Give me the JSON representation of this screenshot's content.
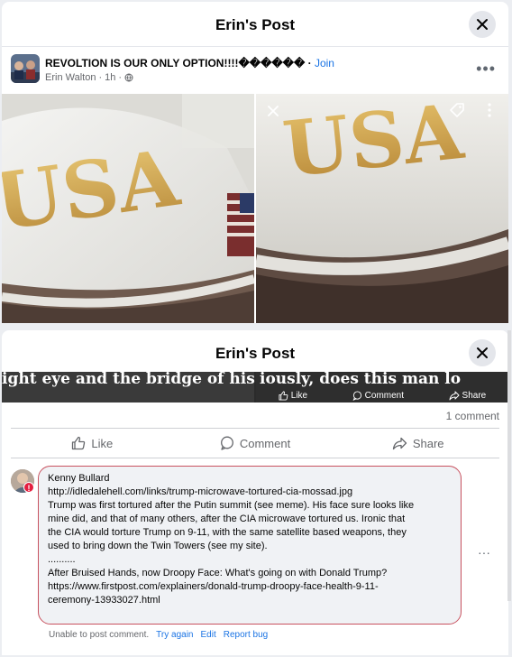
{
  "modal1": {
    "title": "Erin's Post",
    "group_name": "REVOLTION IS OUR ONLY OPTION!!!!������",
    "join_label": "Join",
    "author": "Erin Walton",
    "time": "1h"
  },
  "photos": {
    "cap_text": "USA"
  },
  "modal2": {
    "title": "Erin's Post",
    "strip_left_text": "ight eye and the bridge of his n",
    "strip_right_text": "iously, does this man lo",
    "overlay_like": "Like",
    "overlay_comment": "Comment",
    "overlay_share": "Share",
    "comments_count": "1 comment",
    "like_label": "Like",
    "comment_label": "Comment",
    "share_label": "Share"
  },
  "comment": {
    "author": "Kenny Bullard",
    "lines": [
      "http://idledalehell.com/links/trump-microwave-tortured-cia-mossad.jpg",
      "Trump was first tortured after the Putin summit (see meme). His face sure looks like",
      "mine did, and that of many others, after the CIA microwave tortured us. Ironic that",
      "the CIA would torture Trump on 9-11, with the same satellite based weapons, they",
      "used to bring down the Twin Towers (see my site).",
      "..........",
      "After Bruised Hands, now Droopy Face: What's going on with Donald Trump?",
      "https://www.firstpost.com/explainers/donald-trump-droopy-face-health-9-11-",
      "ceremony-13933027.html"
    ],
    "status": "Unable to post comment.",
    "try_again": "Try again",
    "edit": "Edit",
    "report_bug": "Report bug"
  },
  "colors": {
    "accent": "#1b74e4",
    "error": "#e41e3f",
    "bubble_border": "#c8525f"
  }
}
